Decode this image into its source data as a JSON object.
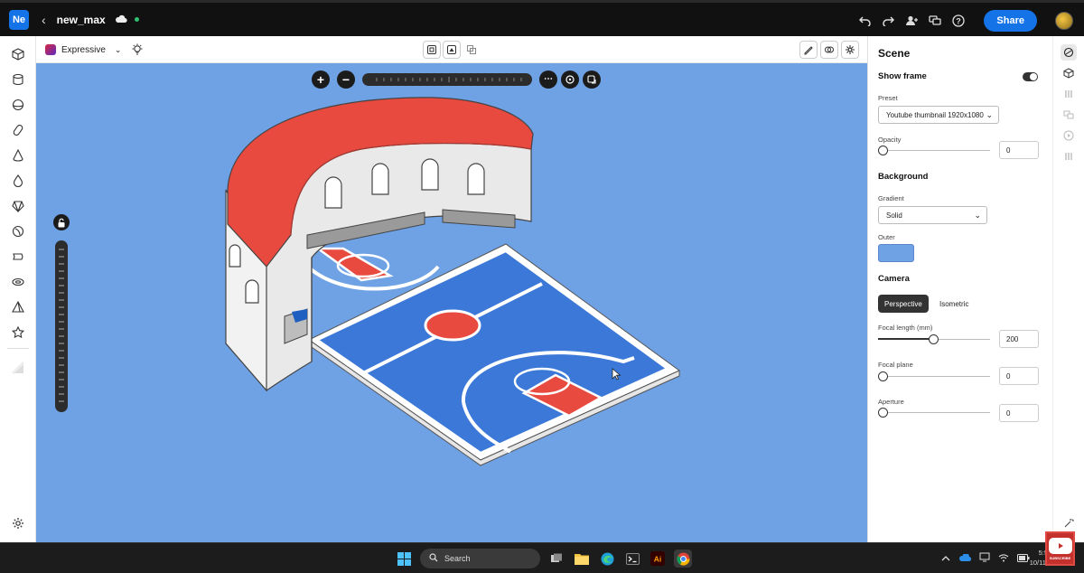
{
  "app": {
    "logo": "Ne",
    "doc_name": "new_max",
    "share_label": "Share"
  },
  "toolbar": {
    "style_label": "Expressive"
  },
  "panel": {
    "title": "Scene",
    "show_frame_label": "Show frame",
    "show_frame_on": true,
    "preset_label": "Preset",
    "preset_value": "Youtube thumbnail 1920x1080",
    "opacity_label": "Opacity",
    "opacity_value": "0",
    "background_title": "Background",
    "gradient_label": "Gradient",
    "gradient_value": "Solid",
    "outer_label": "Outer",
    "outer_color": "#6fa1e5",
    "camera_title": "Camera",
    "camera_modes": [
      "Perspective",
      "Isometric"
    ],
    "camera_active": "Perspective",
    "focal_length_label": "Focal length (mm)",
    "focal_length_value": "200",
    "focal_plane_label": "Focal plane",
    "focal_plane_value": "0",
    "aperture_label": "Aperture",
    "aperture_value": "0"
  },
  "taskbar": {
    "search_label": "Search",
    "clock_time": "5:5",
    "clock_date": "10/11/"
  },
  "badge": {
    "label": "SUBSCRIBE"
  },
  "colors": {
    "canvas": "#6fa1e5",
    "court": "#3b78d8",
    "stands": "#e84a3f",
    "accent": "#1473e6"
  }
}
